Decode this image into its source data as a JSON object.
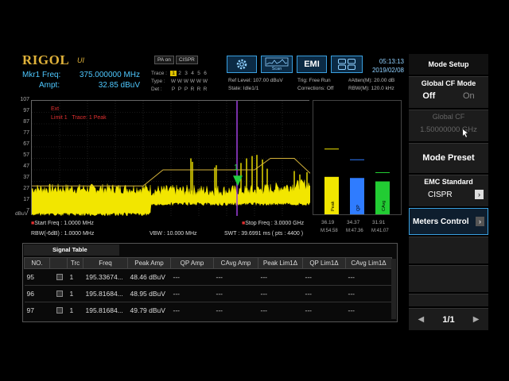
{
  "brand": {
    "logo": "RIGOL",
    "logo_sub": "UI"
  },
  "marker": {
    "freq_label": "Mkr1 Freq:",
    "freq_value": "375.000000 MHz",
    "ampt_label": "Ampt:",
    "ampt_value": "32.85 dBuV"
  },
  "toolbar": {
    "pa_on": "PA on",
    "cispr": "CISPR",
    "trace_label": "Trace :",
    "type_label": "Type :",
    "det_label": "Det :",
    "trace_nums": [
      "1",
      "2",
      "3",
      "4",
      "5",
      "6"
    ],
    "type_vals": [
      "W",
      "W",
      "W",
      "W",
      "W",
      "W"
    ],
    "det_vals": [
      "P",
      "P",
      "P",
      "R",
      "R",
      "R"
    ],
    "scan_label": "Scan",
    "emi_label": "EMI"
  },
  "settings": {
    "ref_level": "Ref Level: 107.00 dBuV",
    "state": "State: Idle1/1",
    "trig": "Trig: Free Run",
    "corrections": "Corrections: Off",
    "atten": "#Atten(M): 20.00 dB",
    "rbw_m": "RBW(M): 120.0 kHz"
  },
  "clock": {
    "time": "05:13:13",
    "date": "2019/02/08"
  },
  "plot": {
    "yticks": [
      "107",
      "97",
      "87",
      "77",
      "67",
      "57",
      "47",
      "37",
      "27",
      "17",
      "7"
    ],
    "yunit": "dBuV",
    "limit_line1": "Limit 1",
    "limit_text": "Trace: 1  Peak",
    "start_freq": "Start Freq : 1.0000 MHz",
    "stop_freq": "Stop Freq : 3.0000 GHz",
    "rbw": "RBW(-6dB) : 1.0000 MHz",
    "vbw": "VBW : 10.000 MHz",
    "swt": "SWT : 39.6991 ms ( pts : 4400 )",
    "marker_num": "1",
    "colors": {
      "trace": "#f2e600",
      "limit": "#d4b23a",
      "marker_line": "#a040e0",
      "marker": "#22d040"
    }
  },
  "meters": {
    "values": [
      {
        "label": "Peak",
        "value": "36.19",
        "max": "M:54.58",
        "color": "#f2e600",
        "level": 0.33
      },
      {
        "label": "QP",
        "value": "34.37",
        "max": "M:47.36",
        "color": "#2f7cff",
        "level": 0.32
      },
      {
        "label": "CAvg",
        "value": "31.91",
        "max": "M:41.07",
        "color": "#22cc33",
        "level": 0.29
      }
    ]
  },
  "signal_table": {
    "title": "Signal Table",
    "headers": [
      "NO.",
      "",
      "Trc",
      "Freq",
      "Peak Amp",
      "QP Amp",
      "CAvg Amp",
      "Peak Lim1Δ",
      "QP Lim1Δ",
      "CAvg Lim1Δ"
    ],
    "rows": [
      [
        "95",
        "",
        "1",
        "195.33674...",
        "48.46 dBuV",
        "---",
        "---",
        "---",
        "---",
        "---"
      ],
      [
        "96",
        "",
        "1",
        "195.81684...",
        "48.95 dBuV",
        "---",
        "---",
        "---",
        "---",
        "---"
      ],
      [
        "97",
        "",
        "1",
        "195.81684...",
        "49.79 dBuV",
        "---",
        "---",
        "---",
        "---",
        "---"
      ]
    ]
  },
  "right_panel": {
    "title": "Mode Setup",
    "global_cf_mode": "Global CF Mode",
    "off": "Off",
    "on": "On",
    "global_cf": "Global CF",
    "global_cf_value": "1.50000000 GHz",
    "mode_preset": "Mode Preset",
    "emc_standard": "EMC Standard",
    "emc_value": "CISPR",
    "meters_control": "Meters Control",
    "page": "1/1"
  }
}
